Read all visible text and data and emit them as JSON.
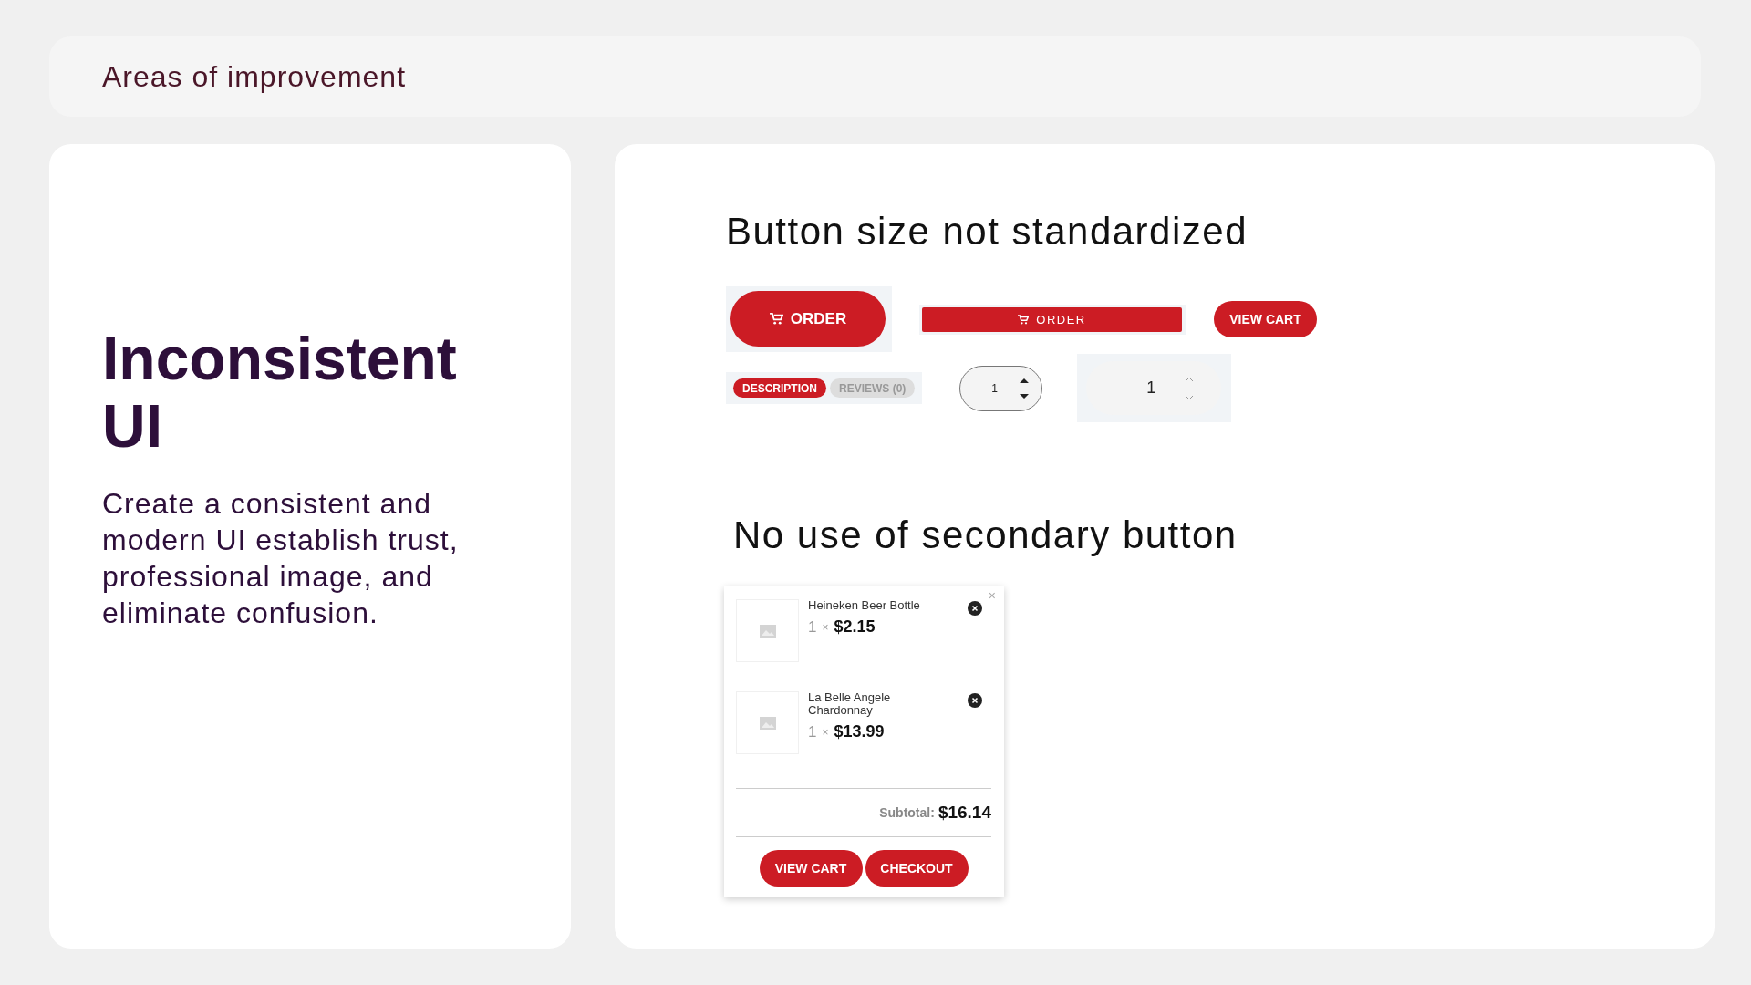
{
  "header": {
    "title": "Areas of improvement"
  },
  "intro": {
    "title": "Inconsistent UI",
    "text": "Create a consistent and modern UI establish trust, professional image, and eliminate confusion."
  },
  "button_section": {
    "heading": "Button size not standardized",
    "order_buttons": [
      "ORDER",
      "ORDER"
    ],
    "view_cart": "VIEW CART",
    "tabs": [
      {
        "label": "DESCRIPTION",
        "selected": true
      },
      {
        "label": "REVIEWS (0)",
        "selected": false
      }
    ],
    "steppers": [
      {
        "value": "1"
      },
      {
        "value": "1"
      }
    ]
  },
  "cart_section": {
    "heading": "No use of secondary button",
    "close": "×",
    "items": [
      {
        "name": "Heineken Beer Bottle",
        "qty": "1",
        "times": "×",
        "price": "$2.15"
      },
      {
        "name": "La Belle Angele Chardonnay",
        "qty": "1",
        "times": "×",
        "price": "$13.99"
      }
    ],
    "subtotal_label": "Subtotal:",
    "subtotal": "$16.14",
    "buttons": [
      "VIEW CART",
      "CHECKOUT"
    ]
  }
}
